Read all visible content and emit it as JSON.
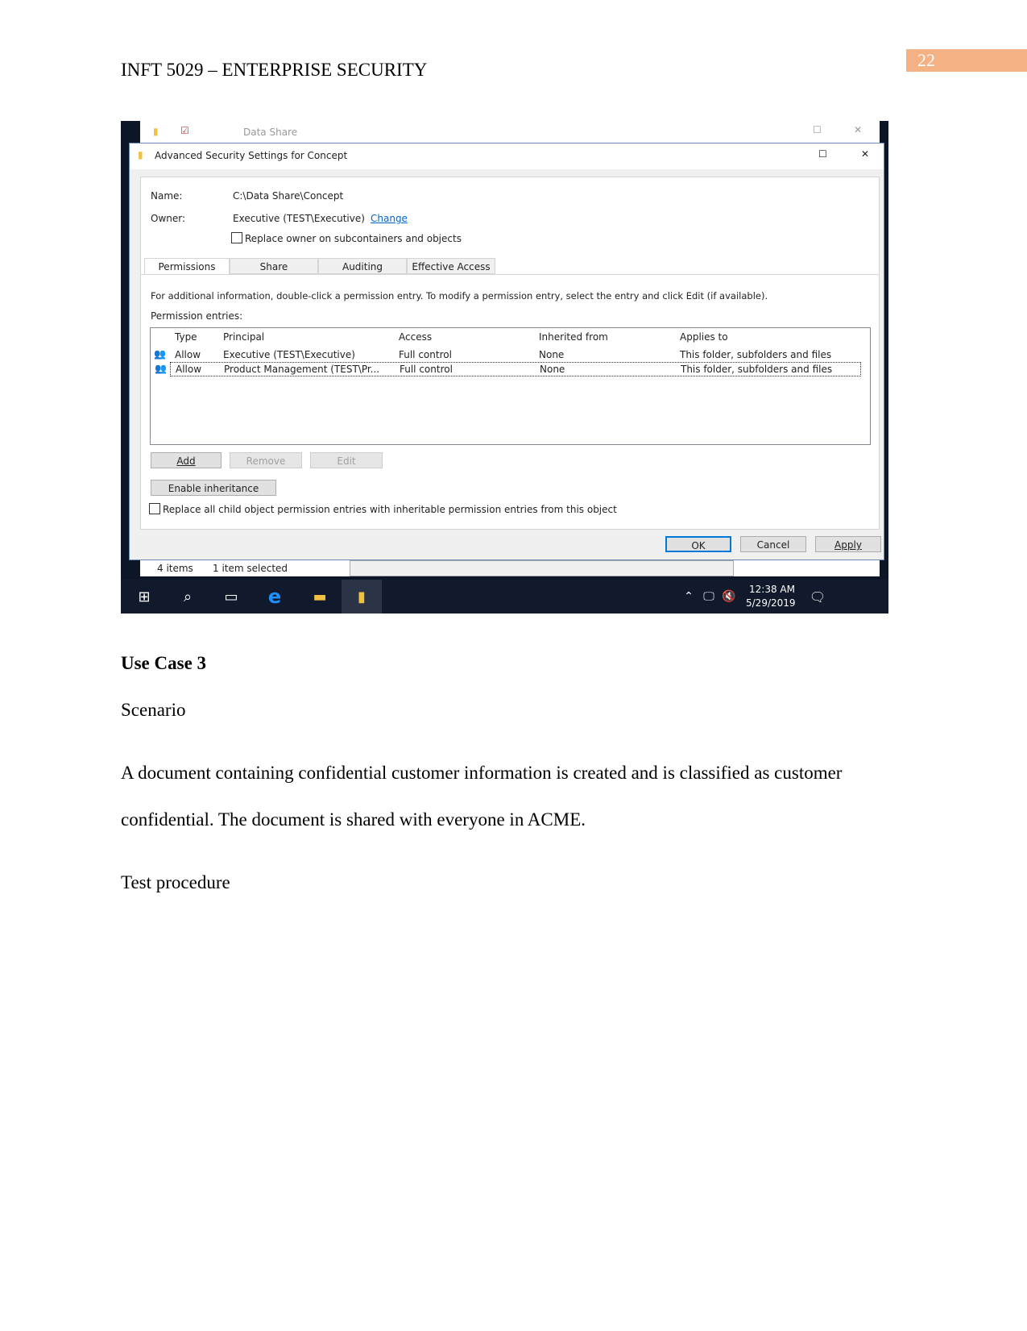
{
  "header": {
    "title": "INFT 5029 – ENTERPRISE SECURITY",
    "page_number": "22"
  },
  "screenshot": {
    "explorer_title": "Data Share",
    "dialog_title": "Advanced Security Settings for Concept",
    "name_label": "Name:",
    "name_value": "C:\\Data Share\\Concept",
    "owner_label": "Owner:",
    "owner_value": "Executive (TEST\\Executive)",
    "change_link": "Change",
    "replace_owner": "Replace owner on subcontainers and objects",
    "tabs": [
      "Permissions",
      "Share",
      "Auditing",
      "Effective Access"
    ],
    "info": "For additional information, double-click a permission entry. To modify a permission entry, select the entry and click Edit (if available).",
    "entries_label": "Permission entries:",
    "columns": [
      "Type",
      "Principal",
      "Access",
      "Inherited from",
      "Applies to"
    ],
    "rows": [
      [
        "Allow",
        "Executive (TEST\\Executive)",
        "Full control",
        "None",
        "This folder, subfolders and files"
      ],
      [
        "Allow",
        "Product Management (TEST\\Pr...",
        "Full control",
        "None",
        "This folder, subfolders and files"
      ]
    ],
    "add": "Add",
    "remove": "Remove",
    "edit": "Edit",
    "enable_inheritance": "Enable inheritance",
    "replace_child": "Replace all child object permission entries with inheritable permission entries from this object",
    "ok": "OK",
    "cancel": "Cancel",
    "apply": "Apply",
    "status_items": "4 items",
    "status_selected": "1 item selected",
    "clock_time": "12:38 AM",
    "clock_date": "5/29/2019"
  },
  "body": {
    "use_case": "Use Case 3",
    "scenario": "Scenario",
    "para_line1": "A document containing confidential customer information is created and is classified as customer",
    "para_line2": "confidential. The document is shared with everyone in ACME.",
    "test_procedure": "Test procedure"
  }
}
